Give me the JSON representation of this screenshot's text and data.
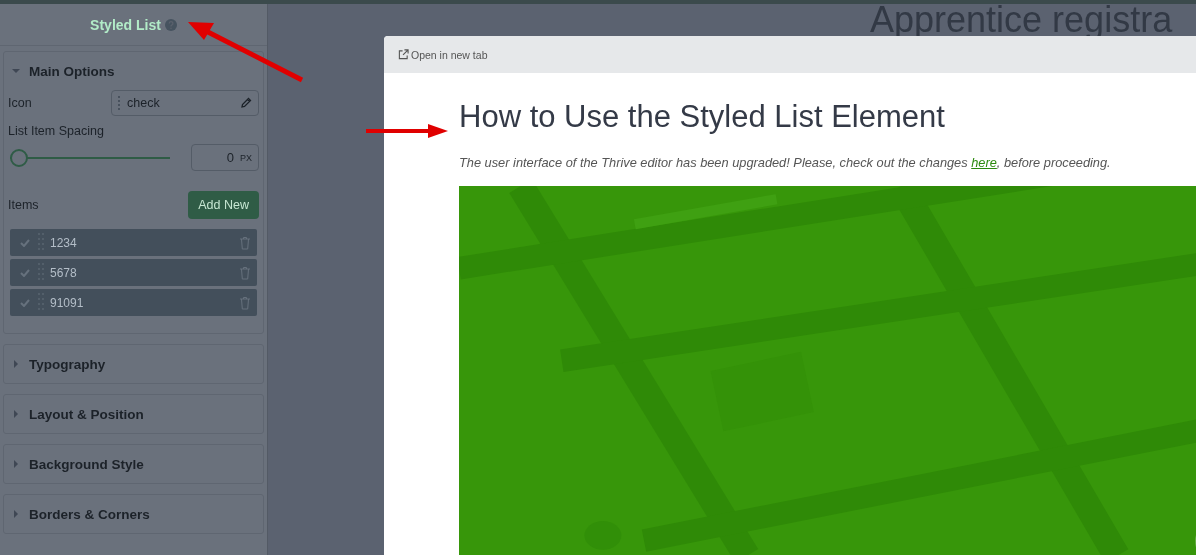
{
  "sidebar": {
    "title": "Styled List",
    "sections": [
      {
        "title": "Main Options",
        "expanded": true
      },
      {
        "title": "Typography",
        "expanded": false
      },
      {
        "title": "Layout & Position",
        "expanded": false
      },
      {
        "title": "Background Style",
        "expanded": false
      },
      {
        "title": "Borders & Corners",
        "expanded": false
      }
    ],
    "main_options": {
      "icon_label": "Icon",
      "icon_value": "check",
      "spacing_label": "List Item Spacing",
      "spacing": {
        "level": 0,
        "value": "0",
        "unit": "PX"
      },
      "items_label": "Items",
      "add_button": "Add New",
      "items": [
        {
          "text": "1234"
        },
        {
          "text": "5678"
        },
        {
          "text": "91091"
        }
      ]
    }
  },
  "page": {
    "heading": "Apprentice registra"
  },
  "modal": {
    "open_link": "Open in new tab",
    "title": "How to Use the Styled List Element",
    "intro": {
      "before": "The user interface of the Thrive editor has been upgraded! Please, check out the changes ",
      "link": "here",
      "after": ", before proceeding."
    }
  }
}
